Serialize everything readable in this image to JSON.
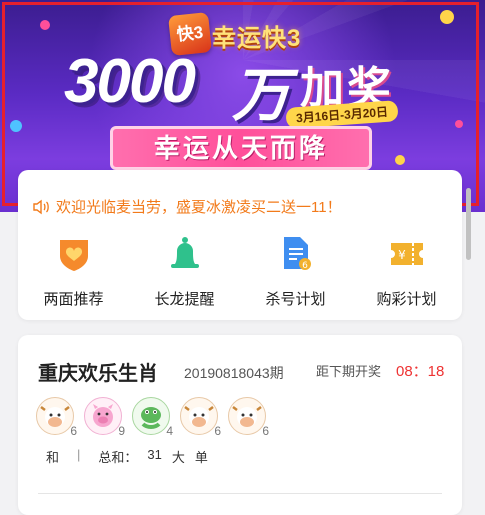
{
  "banner": {
    "logo_text": "快3",
    "brand": "幸运快3",
    "amount": "3000",
    "unit": "万",
    "bonus": "加奖",
    "date_range": "3月16日-3月20日",
    "slogan": "幸运从天而降"
  },
  "notice": {
    "text": "欢迎光临麦当劳，盛夏冰激凌买二送一11！"
  },
  "menu": {
    "items": [
      {
        "label": "两面推荐",
        "icon": "heart-shield-icon",
        "color": "#f58a2c"
      },
      {
        "label": "长龙提醒",
        "icon": "bell-icon",
        "color": "#2fc18c"
      },
      {
        "label": "杀号计划",
        "icon": "document-icon",
        "color": "#3f8ef0"
      },
      {
        "label": "购彩计划",
        "icon": "ticket-icon",
        "color": "#f2b12e"
      }
    ]
  },
  "lottery": {
    "name": "重庆欢乐生肖",
    "issue": "20190818043期",
    "countdown_label": "距下期开奖",
    "countdown": "08：18",
    "balls": [
      {
        "num": "6",
        "icon": "cow-icon"
      },
      {
        "num": "9",
        "icon": "pig-icon"
      },
      {
        "num": "4",
        "icon": "snake-icon"
      },
      {
        "num": "6",
        "icon": "cow-icon"
      },
      {
        "num": "6",
        "icon": "cow-icon"
      }
    ],
    "stats": [
      "和",
      "|",
      "总和：",
      "31",
      "大",
      "单"
    ]
  }
}
